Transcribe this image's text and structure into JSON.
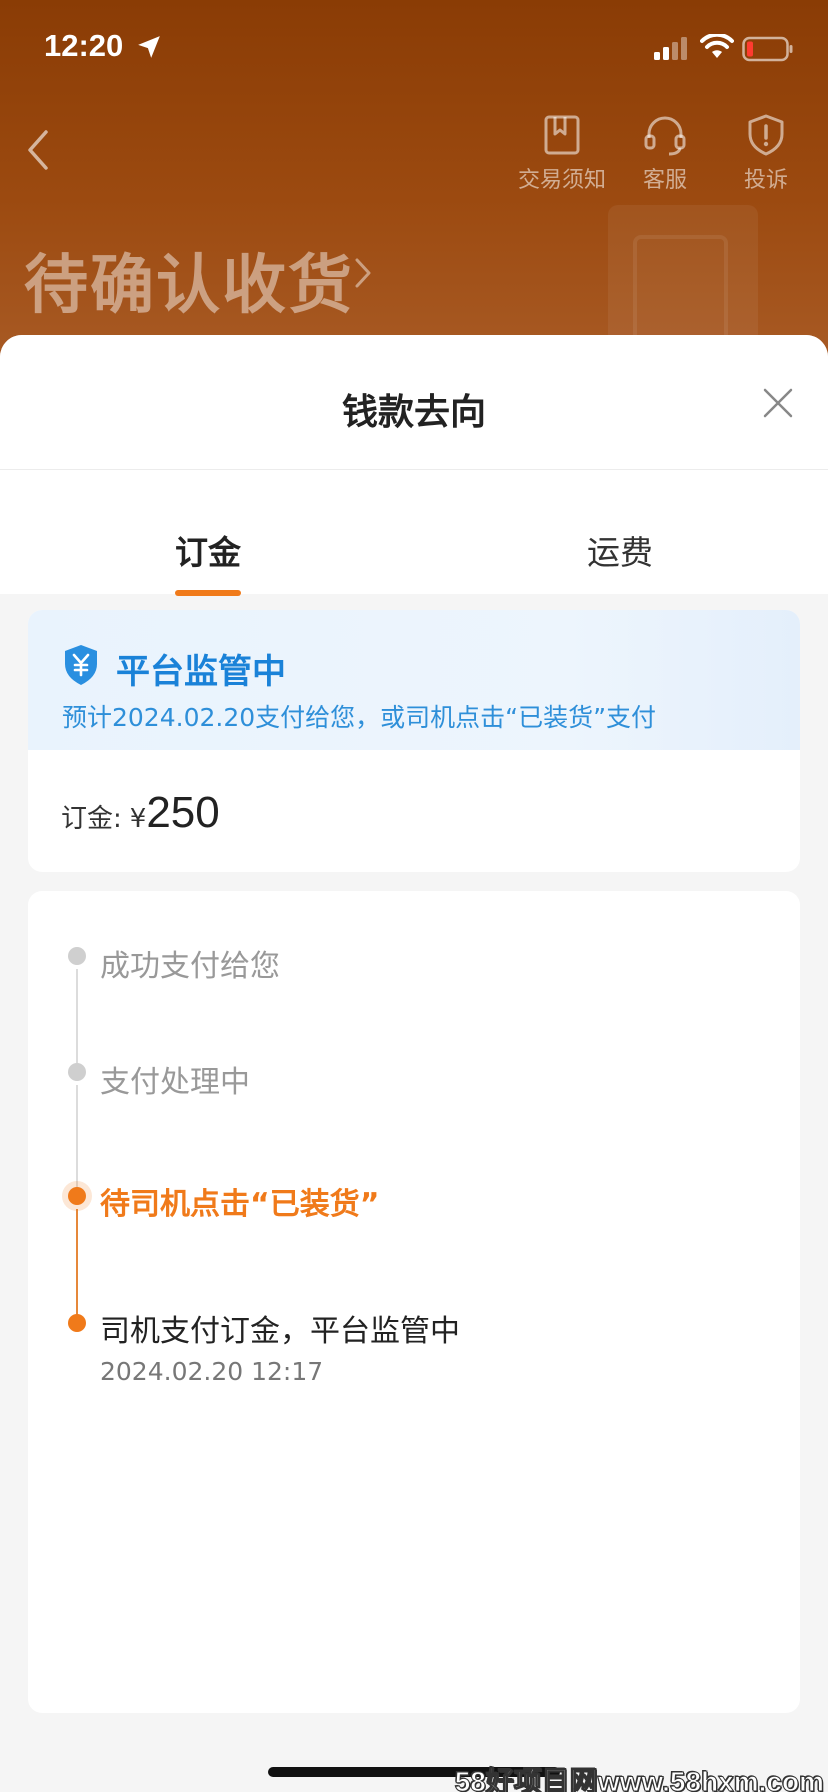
{
  "status_bar": {
    "time": "12:20"
  },
  "header": {
    "actions": [
      {
        "label": "交易须知",
        "icon": "book-icon"
      },
      {
        "label": "客服",
        "icon": "headset-icon"
      },
      {
        "label": "投诉",
        "icon": "shield-alert-icon"
      }
    ],
    "title": "待确认收货"
  },
  "sheet": {
    "title": "钱款去向",
    "tabs": [
      {
        "label": "订金",
        "active": true
      },
      {
        "label": "运费",
        "active": false
      }
    ]
  },
  "supervision": {
    "title": "平台监管中",
    "subtitle": "预计2024.02.20支付给您，或司机点击“已装货”支付",
    "deposit_label": "订金:",
    "currency": "¥",
    "deposit_value": "250"
  },
  "timeline": [
    {
      "text": "成功支付给您",
      "state": "pending"
    },
    {
      "text": "支付处理中",
      "state": "pending"
    },
    {
      "text": "待司机点击“已装货”",
      "state": "current"
    },
    {
      "text": "司机支付订金，平台监管中",
      "state": "done",
      "time": "2024.02.20 12:17"
    }
  ],
  "colors": {
    "accent": "#f07a1a",
    "blue": "#1a82d8",
    "header_brown": "#8a3c05"
  },
  "watermark": "58好项目网www.58hxm.com"
}
